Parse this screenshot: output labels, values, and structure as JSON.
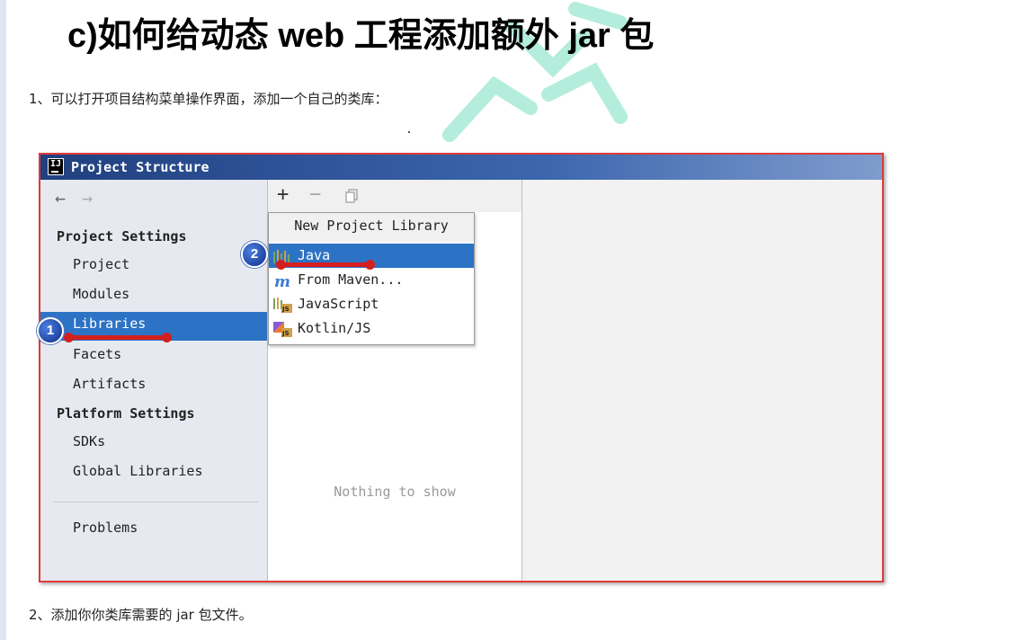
{
  "doc": {
    "heading": "c)如何给动态 web 工程添加额外 jar 包",
    "step1": "1、可以打开项目结构菜单操作界面，添加一个自己的类库：",
    "step2": "2、添加你你类库需要的 jar 包文件。"
  },
  "dialog": {
    "title": "Project Structure",
    "app_icon_text": "IJ",
    "nav": {
      "back": "←",
      "forward": "→"
    },
    "sidebar": {
      "project_settings_header": "Project Settings",
      "project_settings_items": [
        "Project",
        "Modules",
        "Libraries",
        "Facets",
        "Artifacts"
      ],
      "platform_settings_header": "Platform Settings",
      "platform_settings_items": [
        "SDKs",
        "Global Libraries"
      ],
      "problems": "Problems",
      "selected_item": "Libraries"
    },
    "toolbar": {
      "add": "+",
      "remove": "−"
    },
    "empty_text": "Nothing to show",
    "popup": {
      "header": "New Project Library",
      "items": [
        {
          "label": "Java",
          "icon": "java-library-icon"
        },
        {
          "label": "From Maven...",
          "icon": "maven-icon"
        },
        {
          "label": "JavaScript",
          "icon": "javascript-library-icon"
        },
        {
          "label": "Kotlin/JS",
          "icon": "kotlin-js-icon"
        }
      ],
      "selected_item": "Java"
    },
    "annotations": {
      "badge_1": "1",
      "badge_2": "2"
    }
  },
  "colors": {
    "selection": "#2d73c5",
    "annotation_red": "#d41f1f",
    "frame_red": "#e03a3a",
    "titlebar_blue": "#20407f"
  }
}
